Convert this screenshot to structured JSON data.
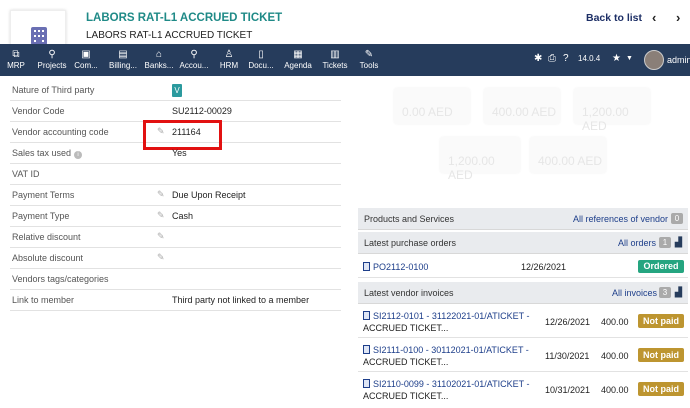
{
  "header": {
    "title": "LABORS RAT-L1 ACCRUED TICKET",
    "subtitle": "LABORS RAT-L1 ACCRUED TICKET",
    "back_label": "Back to list",
    "prev_icon": "chevron-left-icon",
    "next_icon": "chevron-right-icon"
  },
  "menu": {
    "items": [
      {
        "label": "MRP",
        "icon": "sitemap-icon"
      },
      {
        "label": "Projects",
        "icon": "project-icon"
      },
      {
        "label": "Com...",
        "icon": "briefcase-icon"
      },
      {
        "label": "Billing...",
        "icon": "invoice-icon"
      },
      {
        "label": "Banks...",
        "icon": "bank-icon"
      },
      {
        "label": "Accou...",
        "icon": "search-dollar-icon"
      },
      {
        "label": "HRM",
        "icon": "user-tie-icon"
      },
      {
        "label": "Docu...",
        "icon": "document-icon"
      },
      {
        "label": "Agenda",
        "icon": "calendar-icon"
      },
      {
        "label": "Tickets",
        "icon": "ticket-icon"
      },
      {
        "label": "Tools",
        "icon": "wrench-icon"
      }
    ],
    "version": "14.0.4",
    "user": "admin"
  },
  "fields": [
    {
      "label": "Nature of Third party",
      "value": "V",
      "editable": false
    },
    {
      "label": "Vendor Code",
      "value": "SU2112-00029",
      "editable": false
    },
    {
      "label": "Vendor accounting code",
      "value": "211164",
      "editable": true
    },
    {
      "label": "Sales tax used",
      "value": "Yes",
      "editable": false
    },
    {
      "label": "VAT ID",
      "value": "",
      "editable": false
    },
    {
      "label": "Payment Terms",
      "value": "Due Upon Receipt",
      "editable": true
    },
    {
      "label": "Payment Type",
      "value": "Cash",
      "editable": true
    },
    {
      "label": "Relative discount",
      "value": "",
      "editable": true
    },
    {
      "label": "Absolute discount",
      "value": "",
      "editable": true
    },
    {
      "label": "Vendors tags/categories",
      "value": "",
      "editable": false
    },
    {
      "label": "Link to member",
      "value": "Third party not linked to a member",
      "editable": false
    }
  ],
  "stats": [
    "0.00 AED",
    "400.00 AED",
    "1,200.00 AED",
    "1,200.00 AED",
    "400.00 AED"
  ],
  "panels": {
    "products": {
      "title": "Products and Services",
      "link": "All references of vendor",
      "count": "0"
    },
    "orders": {
      "title": "Latest purchase orders",
      "link": "All orders",
      "count": "1",
      "rows": [
        {
          "ref": "PO2112-0100",
          "date": "12/26/2021",
          "status": "Ordered"
        }
      ]
    },
    "invoices": {
      "title": "Latest vendor invoices",
      "link": "All invoices",
      "count": "3",
      "rows": [
        {
          "ref": "SI2112-0101",
          "desc1": " - 31122021-01/ATICKET -",
          "desc2": "ACCRUED TICKET...",
          "date": "12/26/2021",
          "amount": "400.00",
          "status": "Not paid"
        },
        {
          "ref": "SI2111-0100",
          "desc1": " - 30112021-01/ATICKET -",
          "desc2": "ACCRUED TICKET...",
          "date": "11/30/2021",
          "amount": "400.00",
          "status": "Not paid"
        },
        {
          "ref": "SI2110-0099",
          "desc1": " - 31102021-01/ATICKET -",
          "desc2": "ACCRUED TICKET...",
          "date": "10/31/2021",
          "amount": "400.00",
          "status": "Not paid"
        }
      ]
    }
  }
}
